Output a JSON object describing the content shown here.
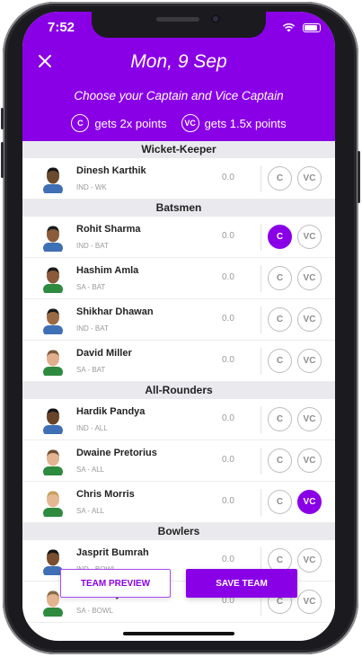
{
  "status_bar": {
    "time": "7:52"
  },
  "header": {
    "date": "Mon, 9 Sep",
    "subtitle": "Choose your Captain and Vice Captain",
    "captain_badge": "C",
    "captain_text": "gets 2x points",
    "vice_badge": "VC",
    "vice_text": "gets 1.5x points"
  },
  "colors": {
    "accent": "#8a00e6",
    "section_bg": "#e9e9ee"
  },
  "sections": [
    {
      "title": "Wicket-Keeper",
      "players": [
        {
          "name": "Dinesh Karthik",
          "team": "IND - WK",
          "points": "0.0",
          "c": false,
          "vc": false,
          "skin": "#6b4a2e",
          "shirt": "#3f6fb5",
          "hair": "#151515"
        }
      ]
    },
    {
      "title": "Batsmen",
      "players": [
        {
          "name": "Rohit Sharma",
          "team": "IND - BAT",
          "points": "0.0",
          "c": true,
          "vc": false,
          "skin": "#8a5c3b",
          "shirt": "#3f6fb5",
          "hair": "#1a1a1a"
        },
        {
          "name": "Hashim Amla",
          "team": "SA - BAT",
          "points": "0.0",
          "c": false,
          "vc": false,
          "skin": "#8a5a3a",
          "shirt": "#2e8a3e",
          "hair": "#1a1a1a"
        },
        {
          "name": "Shikhar Dhawan",
          "team": "IND - BAT",
          "points": "0.0",
          "c": false,
          "vc": false,
          "skin": "#9b6a44",
          "shirt": "#3f6fb5",
          "hair": "#1a1a1a"
        },
        {
          "name": "David Miller",
          "team": "SA - BAT",
          "points": "0.0",
          "c": false,
          "vc": false,
          "skin": "#e0b08e",
          "shirt": "#2e8a3e",
          "hair": "#7a5a3a"
        }
      ]
    },
    {
      "title": "All-Rounders",
      "players": [
        {
          "name": "Hardik Pandya",
          "team": "IND - ALL",
          "points": "0.0",
          "c": false,
          "vc": false,
          "skin": "#6a4428",
          "shirt": "#3f6fb5",
          "hair": "#151515"
        },
        {
          "name": "Dwaine Pretorius",
          "team": "SA - ALL",
          "points": "0.0",
          "c": false,
          "vc": false,
          "skin": "#e2b492",
          "shirt": "#2e8a3e",
          "hair": "#6d4d32"
        },
        {
          "name": "Chris Morris",
          "team": "SA - ALL",
          "points": "0.0",
          "c": false,
          "vc": true,
          "skin": "#e5b894",
          "shirt": "#2e8a3e",
          "hair": "#c8a060"
        }
      ]
    },
    {
      "title": "Bowlers",
      "players": [
        {
          "name": "Jasprit Bumrah",
          "team": "IND - BOWL",
          "points": "0.0",
          "c": false,
          "vc": false,
          "skin": "#7a4e30",
          "shirt": "#3f6fb5",
          "hair": "#151515"
        },
        {
          "name": "Dale Steyn",
          "team": "SA - BOWL",
          "points": "0.0",
          "c": false,
          "vc": false,
          "skin": "#e2b38f",
          "shirt": "#2e8a3e",
          "hair": "#8a6a48"
        }
      ]
    }
  ],
  "buttons": {
    "preview": "TEAM PREVIEW",
    "save": "SAVE TEAM"
  }
}
